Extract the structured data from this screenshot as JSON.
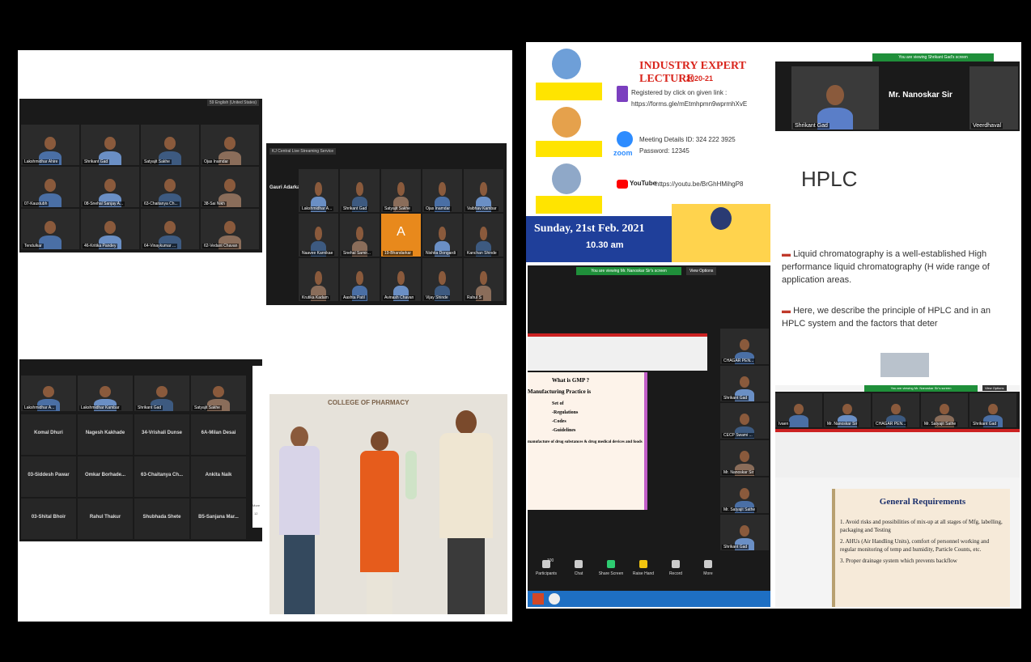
{
  "collage_a": {
    "gallery1": {
      "top_tag": "59 English (United States)",
      "labels": [
        "Lakshmidhar Ahire",
        "Shrikant Gad",
        "Satyajit Sakhe",
        "Ojas Inamdar",
        "07-Kaustubh",
        "08-Snehal Sanjay A...",
        "63-Chaitanya Ch...",
        "38-Sai Nikh",
        "Tendulkar",
        "46-Kritika Pandey",
        "64-Vinaykumar ...",
        "62-Vedant Chavan"
      ]
    },
    "gallery2": {
      "top_tag": "KJ Central Live Streaming Service",
      "presenter": "Gauri Adarkar",
      "labels": [
        "Lakshmidhar A...",
        "Shrikant Gad",
        "Satyajit Sakhe",
        "Ojas Inamdar",
        "Vaibhav Kambar",
        "Naavee Karnikae",
        "Snehal Samir...",
        "19-Bhandarkar",
        "Nishita Dongardi",
        "Kanchan Shinde",
        "Krutika Kadam",
        "Aashta Patil",
        "Avinash Chavan",
        "Vijay Shinde",
        "Rahul S"
      ],
      "avatar_letter": "A"
    },
    "gallery3": {
      "names_row1": [
        "Lakshmidhar A...",
        "Lakshmidhar Kambar",
        "Shrikant Gad",
        "Satyajit Sakhe"
      ],
      "grid": [
        "Komal Dhuri",
        "Nagesh Kakhade",
        "34-Vrishali Dunse",
        "6A-Milan Desai",
        "03-Siddesh Pawar",
        "Omkar Borhade...",
        "63-Chaitanya Ch...",
        "Ankita Naik",
        "03-Shital Bhoir",
        "Rahul Thakur",
        "Shubhada Shete",
        "B5-Sanjana Mar..."
      ],
      "side_text": [
        "More",
        "12"
      ]
    },
    "photo": {
      "banner": "COLLEGE OF PHARMACY"
    }
  },
  "collage_b": {
    "poster": {
      "title_top": "INDUSTRY EXPERT LECTURE",
      "year": "2020-21",
      "registered": "Registered by click on given link :",
      "link": "https://forms.gle/mEtmhpmn9wprmhXvE",
      "meeting": "Meeting Details ID: 324 222 3925",
      "password": "Password: 12345",
      "zoom_label": "zoom",
      "youtube_label": "YouTube",
      "youtube_link": "https://youtu.be/BrGhHMihgP8",
      "date": "Sunday, 21st Feb. 2021",
      "time": "10.30 am"
    },
    "hplc": {
      "banner": "You are viewing Shrikant Gad's screen",
      "speaker": "Mr. Nanoskar Sir",
      "tile1": "Shrikant Gad",
      "tile2": "Veerdhaval",
      "heading": "HPLC",
      "bullet1": "Liquid chromatography is a well-established High performance liquid chromatography (H wide range of application areas.",
      "bullet2": "Here, we describe the principle of HPLC and in an HPLC system and the factors that deter"
    },
    "gmp": {
      "banner": "You are viewing Mr. Nanoskar Sir's screen",
      "view_options": "View Options",
      "slide_title": "What is GMP ?",
      "slide_sub": "Manufacturing Practice is",
      "slide_items": [
        "Set of",
        "-Regulations",
        "-Codes",
        "-Guidelines"
      ],
      "slide_tail": "manufacture of drug substances & drug medical devices and foods",
      "sidebar": [
        "CHAGAR PEN...",
        "Shrikant Gad",
        "CECP Swami ...",
        "Mr. Nanoskar Sir",
        "Mr. Satyajit Sathe",
        "Shrikant Gad"
      ],
      "toolbar": [
        "Participants",
        "Chat",
        "Share Screen",
        "Raise Hand",
        "Record",
        "More"
      ],
      "participant_count": "100"
    },
    "gen_req": {
      "banner": "You are viewing Mr. Nanoskar Sir's screen",
      "view_options": "View Options",
      "strip": [
        "Ivaen",
        "Mr. Nanoskar Sir",
        "CHAGAR PEN...",
        "Mr. Satyajit Sathe",
        "Shrikant Gad"
      ],
      "title": "General Requirements",
      "points": [
        "1. Avoid risks and possibilities of mix-up at all stages of Mfg, labelling, packaging and Testing",
        "2. AHUs (Air Handling Units), comfort of personnel working and regular monitoring of temp and humidity, Particle Counts, etc.",
        "3. Proper drainage system which prevents backflow"
      ]
    }
  },
  "colors": {
    "zoom_bg": "#1a1a1a",
    "tile_bg": "#2b2b2b",
    "banner_green": "#1f8f3a",
    "poster_blue": "#1f3f9a",
    "poster_red": "#d9251c",
    "slide_red": "#cc2222"
  }
}
